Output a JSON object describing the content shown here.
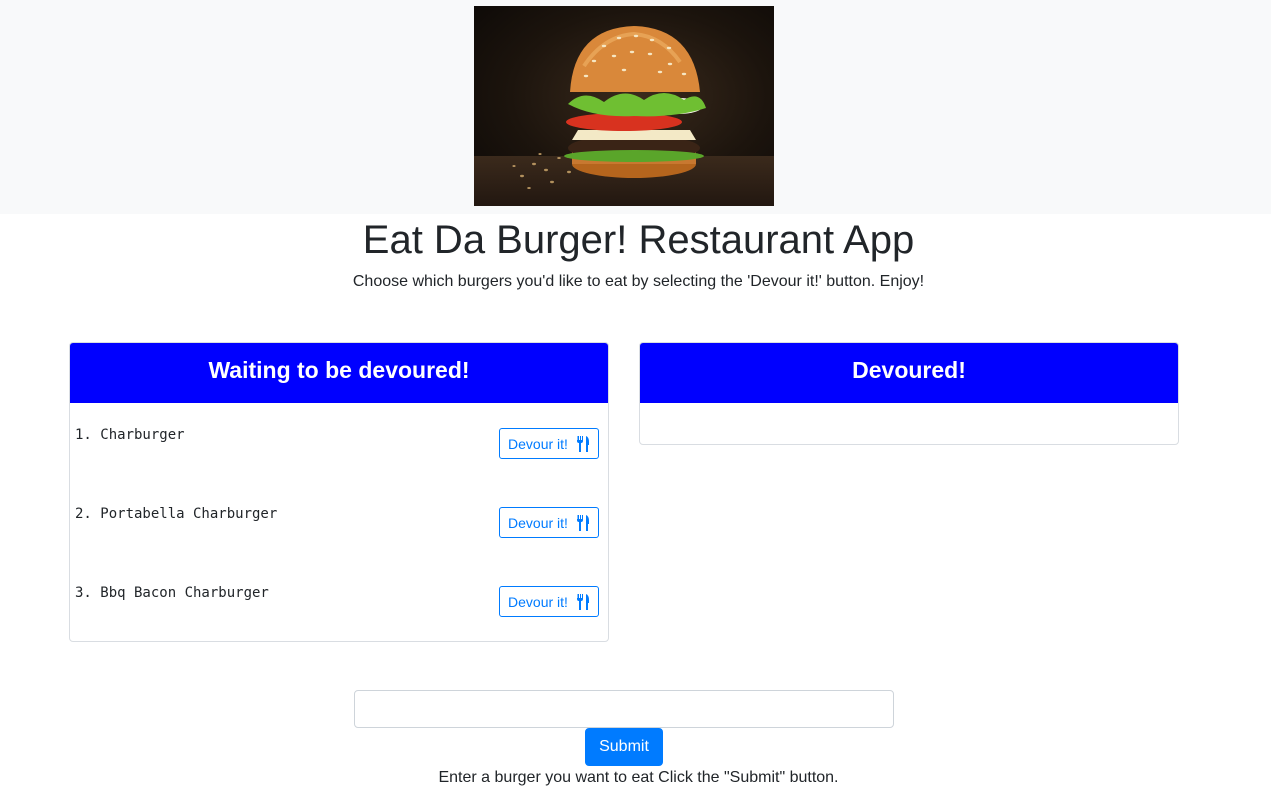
{
  "header": {
    "image_alt": "burger photo"
  },
  "page": {
    "title": "Eat Da Burger! Restaurant App",
    "subtitle": "Choose which burgers you'd like to eat by selecting the 'Devour it!' button. Enjoy!"
  },
  "waiting": {
    "heading": "Waiting to be devoured!",
    "items": [
      {
        "name": "1. Charburger",
        "button_label": "Devour it!"
      },
      {
        "name": "2. Portabella Charburger",
        "button_label": "Devour it!"
      },
      {
        "name": "3. Bbq Bacon Charburger",
        "button_label": "Devour it!"
      }
    ],
    "button_icon": "utensils-icon"
  },
  "devoured": {
    "heading": "Devoured!",
    "items": []
  },
  "form": {
    "input_value": "",
    "input_placeholder": "",
    "submit_label": "Submit",
    "instructions": "Enter a burger you want to eat Click the \"Submit\" button."
  },
  "colors": {
    "card_header_bg": "#0000ff",
    "primary": "#007bff",
    "header_band": "#f8f9fa"
  }
}
